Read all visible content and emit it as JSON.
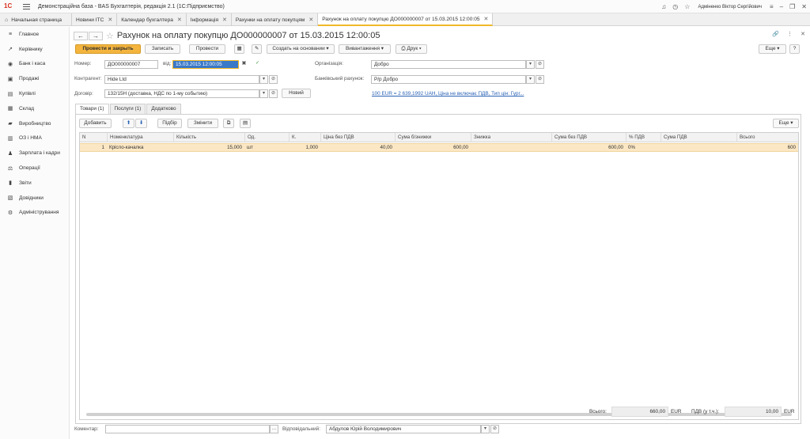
{
  "app": {
    "logo": "1С",
    "title": "Демонстраційна база - BAS Бухгалтерія, редакція 2.1  (1С:Підприємство)",
    "user": "Адміненко Віктор Сергійович"
  },
  "tabs": [
    {
      "label": "Начальная страница"
    },
    {
      "label": "Новини ІТС"
    },
    {
      "label": "Календар бухгалтера"
    },
    {
      "label": "Інформація"
    },
    {
      "label": "Рахунки на оплату покупцям"
    },
    {
      "label": "Рахунок на оплату покупцю ДО000000007 от 15.03.2015 12:00:05"
    }
  ],
  "sidebar": {
    "items": [
      {
        "label": "Главное",
        "icon": "≡"
      },
      {
        "label": "Керівнику",
        "icon": "↗"
      },
      {
        "label": "Банк і каса",
        "icon": "◉"
      },
      {
        "label": "Продажі",
        "icon": "▣"
      },
      {
        "label": "Купівлі",
        "icon": "▤"
      },
      {
        "label": "Склад",
        "icon": "▦"
      },
      {
        "label": "Виробництво",
        "icon": "▰"
      },
      {
        "label": "ОЗ і НМА",
        "icon": "▥"
      },
      {
        "label": "Зарплата і кадри",
        "icon": "♟"
      },
      {
        "label": "Операції",
        "icon": "⚖"
      },
      {
        "label": "Звіти",
        "icon": "▮"
      },
      {
        "label": "Довідники",
        "icon": "▧"
      },
      {
        "label": "Адміністрування",
        "icon": "⚙"
      }
    ]
  },
  "document": {
    "title": "Рахунок на оплату покупцю ДО000000007 от 15.03.2015 12:00:05"
  },
  "toolbar": {
    "post_close": "Провести и закрыть",
    "save": "Записать",
    "post": "Провести",
    "create_based": "Создать на основании",
    "export": "Вивантаження",
    "print": "Друк",
    "more": "Еще"
  },
  "form": {
    "number_label": "Номер:",
    "number_value": "ДО000000007",
    "date_label": "від:",
    "date_value": "15.03.2015 12:00:05",
    "org_label": "Організація:",
    "org_value": "Добро",
    "contractor_label": "Контрагент:",
    "contractor_value": "Hide Ltd",
    "bank_label": "Банківський рахунок:",
    "bank_value": "Р/р Добро",
    "contract_label": "Договір:",
    "contract_value": "132/15Н (доставка, НДС по 1-му событию)",
    "new_button": "Новий",
    "rate_link": "100 EUR = 2 639,1992 UAH, Ціна не включає ПДВ, Тип цін: Гург..."
  },
  "form_tabs": [
    {
      "label": "Товари (1)"
    },
    {
      "label": "Послуги (1)"
    },
    {
      "label": "Додатково"
    }
  ],
  "grid_toolbar": {
    "add": "Добавить",
    "pick": "Підбір",
    "change": "Змінити",
    "more": "Еще"
  },
  "table": {
    "columns": [
      "N",
      "Номенклатура",
      "Кількість",
      "Од.",
      "К.",
      "Ціна без ПДВ",
      "Сума б/знижки",
      "Знижка",
      "Сума без ПДВ",
      "% ПДВ",
      "Сума ПДВ",
      "Всього"
    ],
    "rows": [
      {
        "n": "1",
        "item": "Крісло-качалка",
        "qty": "15,000",
        "unit": "шт",
        "k": "1,000",
        "price": "40,00",
        "sum_nodisc": "600,00",
        "discount": "",
        "sum": "600,00",
        "vat_pct": "0%",
        "vat_sum": "",
        "total": "600"
      }
    ]
  },
  "totals": {
    "total_label": "Всього:",
    "total_value": "660,00",
    "currency": "EUR",
    "vat_label": "ПДВ (у т.ч.):",
    "vat_value": "10,00",
    "vat_currency": "EUR"
  },
  "footer": {
    "comment_label": "Коментар:",
    "comment_value": "",
    "responsible_label": "Відповідальний:",
    "responsible_value": "Абдулов Юрій Володимирович"
  }
}
